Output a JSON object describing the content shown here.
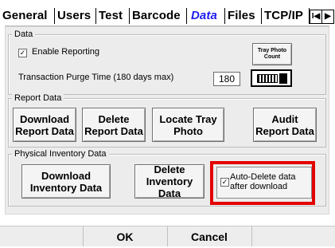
{
  "tabs": [
    "General",
    "Users",
    "Test",
    "Barcode",
    "Data",
    "Files",
    "TCP/IP"
  ],
  "active_tab": "Data",
  "tab_scroll_left": "I◀",
  "tab_scroll_right": "▶",
  "data_group": {
    "title": "Data",
    "enable_reporting_label": "Enable Reporting",
    "enable_reporting_checked": true,
    "checkbox_glyph": "✓",
    "tray_photo_count_label": "Tray Photo\nCount",
    "purge_label": "Transaction Purge Time (180 days max)",
    "purge_value": "180",
    "keyboard_icon": "keyboard-icon"
  },
  "report_group": {
    "title": "Report Data",
    "buttons": [
      "Download\nReport Data",
      "Delete\nReport Data",
      "Locate Tray\nPhoto",
      "Audit\nReport Data"
    ]
  },
  "inventory_group": {
    "title": "Physical Inventory Data",
    "download_label": "Download\nInventory Data",
    "delete_label": "Delete\nInventory Data",
    "auto_delete_label": "Auto-Delete data\nafter download",
    "auto_delete_checked": true
  },
  "footer": {
    "ok_label": "OK",
    "cancel_label": "Cancel"
  },
  "colors": {
    "active_tab": "#1c1cf0",
    "highlight": "#e30000",
    "panel": "#ececec"
  }
}
